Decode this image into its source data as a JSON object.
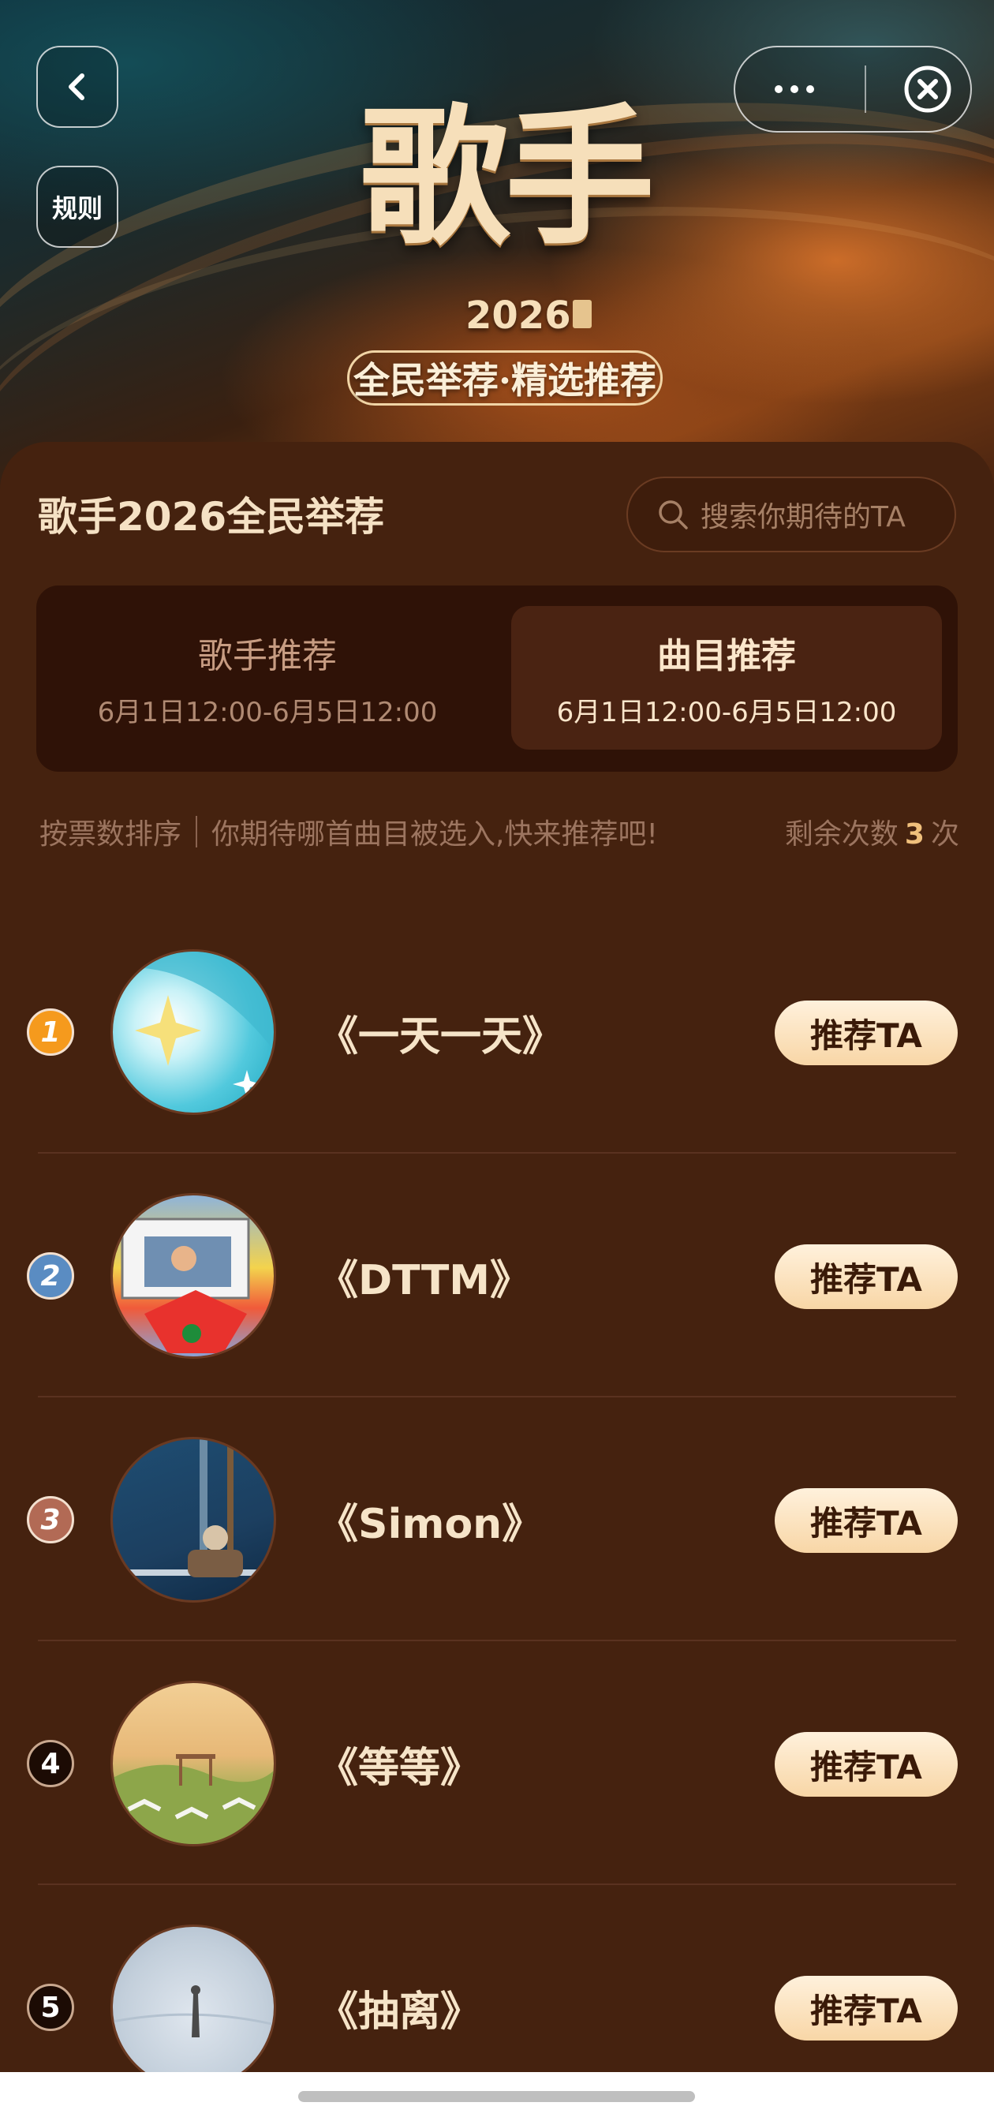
{
  "header": {
    "rules_label": "规则",
    "logo_title": "歌手",
    "logo_year": "2026",
    "logo_subtitle": "全民举荐·精选推荐"
  },
  "panel": {
    "title": "歌手2026全民举荐",
    "search_placeholder": "搜索你期待的TA"
  },
  "tabs": [
    {
      "label": "歌手推荐",
      "date": "6月1日12:00-6月5日12:00",
      "active": false
    },
    {
      "label": "曲目推荐",
      "date": "6月1日12:00-6月5日12:00",
      "active": true
    }
  ],
  "hint": {
    "sort_label": "按票数排序",
    "message": "你期待哪首曲目被选入,快来推荐吧!",
    "remain_prefix": "剩余次数",
    "remain_count": "3",
    "remain_suffix": "次"
  },
  "songs": [
    {
      "rank": "1",
      "title": "《一天一天》",
      "button": "推荐TA"
    },
    {
      "rank": "2",
      "title": "《DTTM》",
      "button": "推荐TA"
    },
    {
      "rank": "3",
      "title": "《Simon》",
      "button": "推荐TA"
    },
    {
      "rank": "4",
      "title": "《等等》",
      "button": "推荐TA"
    },
    {
      "rank": "5",
      "title": "《抽离》",
      "button": "推荐TA"
    }
  ],
  "icons": {
    "back": "chevron-left-icon",
    "more": "more-dots-icon",
    "close": "close-circle-icon",
    "search": "search-icon"
  },
  "colors": {
    "background": "#45220f",
    "accent_button": "#f8d6a6",
    "remain_count": "#f0c07c"
  }
}
